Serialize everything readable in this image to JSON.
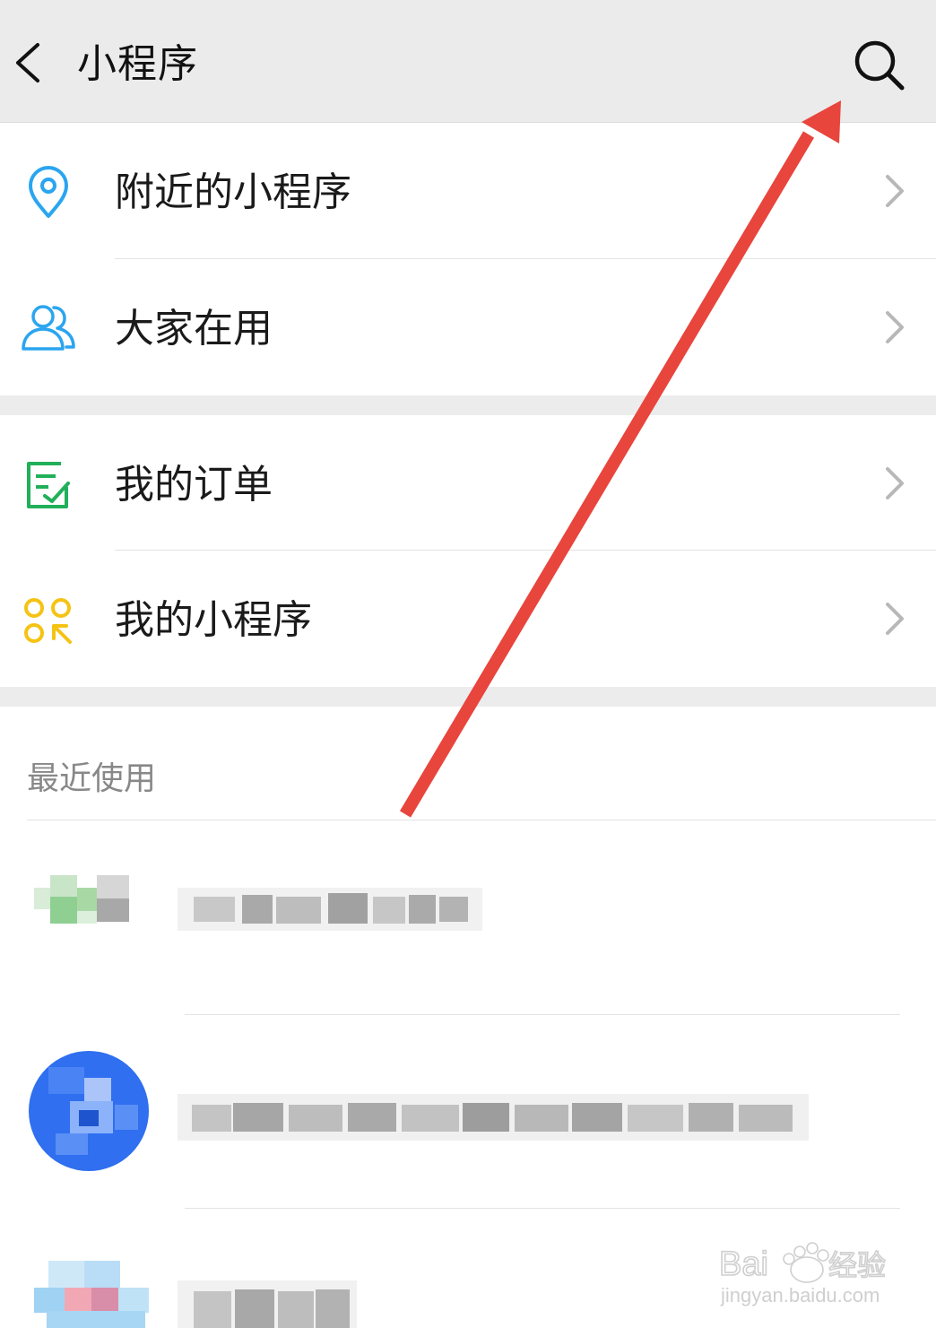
{
  "header": {
    "title": "小程序",
    "back_icon": "chevron-left-icon",
    "search_icon": "search-icon"
  },
  "menu_groups": [
    {
      "items": [
        {
          "label": "附近的小程序",
          "icon": "location-pin-icon",
          "icon_color": "#2aa5f0"
        },
        {
          "label": "大家在用",
          "icon": "people-icon",
          "icon_color": "#2aa5f0"
        }
      ]
    },
    {
      "items": [
        {
          "label": "我的订单",
          "icon": "order-check-icon",
          "icon_color": "#21b05a"
        },
        {
          "label": "我的小程序",
          "icon": "mini-program-grid-icon",
          "icon_color": "#f5c313"
        }
      ]
    }
  ],
  "recent": {
    "title": "最近使用",
    "items": [
      {
        "avatar": "blurred-avatar-green",
        "name": ""
      },
      {
        "avatar": "blurred-avatar-blue",
        "name": ""
      },
      {
        "avatar": "blurred-avatar-lightblue",
        "name": ""
      }
    ]
  },
  "annotation": {
    "type": "red-arrow",
    "color": "#e8453c",
    "target": "search-icon"
  },
  "watermark": {
    "brand": "Baidu经验",
    "url": "jingyan.baidu.com"
  }
}
